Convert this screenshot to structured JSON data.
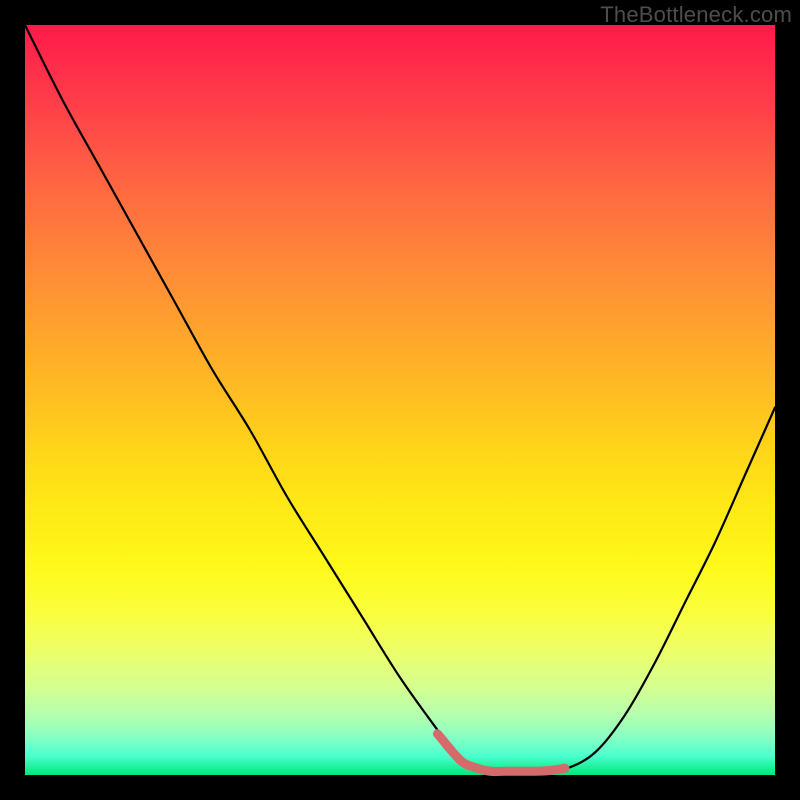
{
  "watermark": "TheBottleneck.com",
  "colors": {
    "curve_stroke": "#000000",
    "highlight_stroke": "#d46a6a",
    "frame": "#000000"
  },
  "chart_data": {
    "type": "line",
    "title": "",
    "xlabel": "",
    "ylabel": "",
    "xlim": [
      0,
      100
    ],
    "ylim": [
      0,
      100
    ],
    "grid": false,
    "legend": false,
    "series": [
      {
        "name": "bottleneck-curve",
        "x": [
          0,
          5,
          10,
          15,
          20,
          25,
          30,
          35,
          40,
          45,
          50,
          55,
          58,
          62,
          65,
          68,
          72,
          76,
          80,
          84,
          88,
          92,
          96,
          100
        ],
        "values": [
          100,
          90,
          81,
          72,
          63,
          54,
          46,
          37,
          29,
          21,
          13,
          6,
          2,
          0.5,
          0.5,
          0.5,
          0.8,
          3,
          8,
          15,
          23,
          31,
          40,
          49
        ]
      },
      {
        "name": "optimal-range-highlight",
        "x": [
          55,
          58,
          60,
          62,
          64,
          66,
          68,
          70,
          72
        ],
        "values": [
          5.5,
          2,
          1,
          0.5,
          0.5,
          0.5,
          0.5,
          0.6,
          0.9
        ]
      }
    ],
    "annotations": []
  }
}
